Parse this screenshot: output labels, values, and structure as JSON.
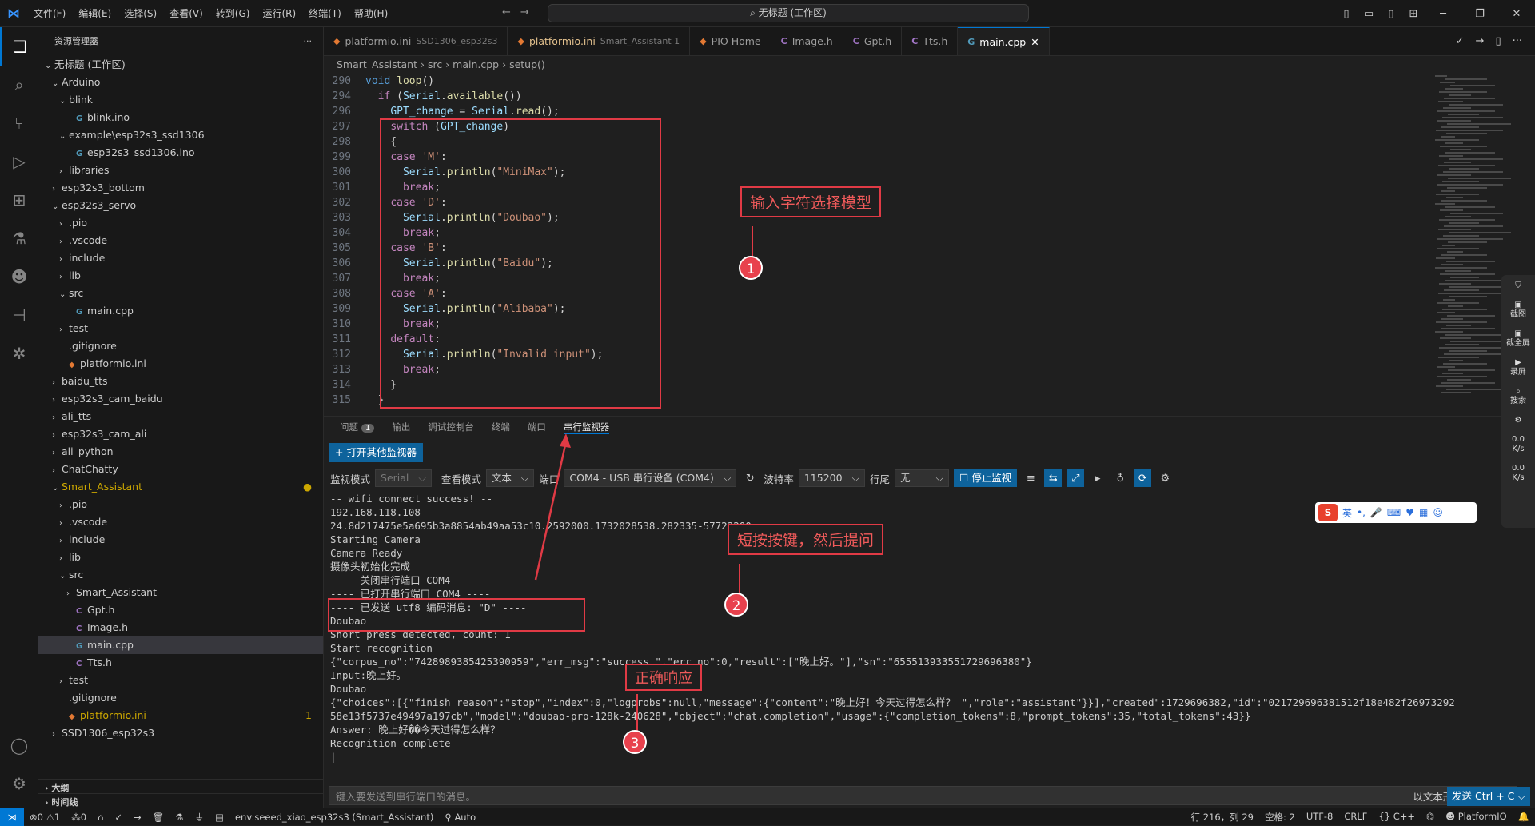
{
  "titlebar": {
    "menu": [
      "文件(F)",
      "编辑(E)",
      "选择(S)",
      "查看(V)",
      "转到(G)",
      "运行(R)",
      "终端(T)",
      "帮助(H)"
    ],
    "search": "无标题 (工作区)"
  },
  "sidebar": {
    "title": "资源管理器",
    "items": [
      {
        "label": "无标题 (工作区)",
        "indent": 0,
        "chev": "v",
        "icon": ""
      },
      {
        "label": "Arduino",
        "indent": 1,
        "chev": "v",
        "icon": ""
      },
      {
        "label": "blink",
        "indent": 2,
        "chev": "v",
        "icon": ""
      },
      {
        "label": "blink.ino",
        "indent": 3,
        "chev": "",
        "icon": "ino"
      },
      {
        "label": "example\\esp32s3_ssd1306",
        "indent": 2,
        "chev": "v",
        "icon": ""
      },
      {
        "label": "esp32s3_ssd1306.ino",
        "indent": 3,
        "chev": "",
        "icon": "ino"
      },
      {
        "label": "libraries",
        "indent": 2,
        "chev": ">",
        "icon": ""
      },
      {
        "label": "esp32s3_bottom",
        "indent": 1,
        "chev": ">",
        "icon": ""
      },
      {
        "label": "esp32s3_servo",
        "indent": 1,
        "chev": "v",
        "icon": ""
      },
      {
        "label": ".pio",
        "indent": 2,
        "chev": ">",
        "icon": ""
      },
      {
        "label": ".vscode",
        "indent": 2,
        "chev": ">",
        "icon": ""
      },
      {
        "label": "include",
        "indent": 2,
        "chev": ">",
        "icon": ""
      },
      {
        "label": "lib",
        "indent": 2,
        "chev": ">",
        "icon": ""
      },
      {
        "label": "src",
        "indent": 2,
        "chev": "v",
        "icon": ""
      },
      {
        "label": "main.cpp",
        "indent": 3,
        "chev": "",
        "icon": "cpp"
      },
      {
        "label": "test",
        "indent": 2,
        "chev": ">",
        "icon": ""
      },
      {
        "label": ".gitignore",
        "indent": 2,
        "chev": "",
        "icon": ""
      },
      {
        "label": "platformio.ini",
        "indent": 2,
        "chev": "",
        "icon": "ini"
      },
      {
        "label": "baidu_tts",
        "indent": 1,
        "chev": ">",
        "icon": ""
      },
      {
        "label": "esp32s3_cam_baidu",
        "indent": 1,
        "chev": ">",
        "icon": ""
      },
      {
        "label": "ali_tts",
        "indent": 1,
        "chev": ">",
        "icon": ""
      },
      {
        "label": "esp32s3_cam_ali",
        "indent": 1,
        "chev": ">",
        "icon": ""
      },
      {
        "label": "ali_python",
        "indent": 1,
        "chev": ">",
        "icon": ""
      },
      {
        "label": "ChatChatty",
        "indent": 1,
        "chev": ">",
        "icon": ""
      },
      {
        "label": "Smart_Assistant",
        "indent": 1,
        "chev": "v",
        "icon": "",
        "mod": true,
        "badge": "●"
      },
      {
        "label": ".pio",
        "indent": 2,
        "chev": ">",
        "icon": ""
      },
      {
        "label": ".vscode",
        "indent": 2,
        "chev": ">",
        "icon": ""
      },
      {
        "label": "include",
        "indent": 2,
        "chev": ">",
        "icon": ""
      },
      {
        "label": "lib",
        "indent": 2,
        "chev": ">",
        "icon": ""
      },
      {
        "label": "src",
        "indent": 2,
        "chev": "v",
        "icon": ""
      },
      {
        "label": "Smart_Assistant",
        "indent": 3,
        "chev": ">",
        "icon": ""
      },
      {
        "label": "Gpt.h",
        "indent": 3,
        "chev": "",
        "icon": "c"
      },
      {
        "label": "Image.h",
        "indent": 3,
        "chev": "",
        "icon": "c"
      },
      {
        "label": "main.cpp",
        "indent": 3,
        "chev": "",
        "icon": "cpp",
        "selected": true
      },
      {
        "label": "Tts.h",
        "indent": 3,
        "chev": "",
        "icon": "c"
      },
      {
        "label": "test",
        "indent": 2,
        "chev": ">",
        "icon": ""
      },
      {
        "label": ".gitignore",
        "indent": 2,
        "chev": "",
        "icon": ""
      },
      {
        "label": "platformio.ini",
        "indent": 2,
        "chev": "",
        "icon": "ini",
        "mod": true,
        "badge": "1"
      },
      {
        "label": "SSD1306_esp32s3",
        "indent": 1,
        "chev": ">",
        "icon": ""
      }
    ],
    "outline": "大纲",
    "timeline": "时间线"
  },
  "tabs": [
    {
      "label": "platformio.ini",
      "sub": "SSD1306_esp32s3",
      "icon": "ini"
    },
    {
      "label": "platformio.ini",
      "sub": "Smart_Assistant 1",
      "icon": "ini",
      "mod": true
    },
    {
      "label": "PIO Home",
      "sub": "",
      "icon": "ini"
    },
    {
      "label": "Image.h",
      "sub": "",
      "icon": "c"
    },
    {
      "label": "Gpt.h",
      "sub": "",
      "icon": "c"
    },
    {
      "label": "Tts.h",
      "sub": "",
      "icon": "c"
    },
    {
      "label": "main.cpp",
      "sub": "",
      "icon": "cpp",
      "active": true,
      "close": "✕"
    }
  ],
  "breadcrumb": [
    "Smart_Assistant",
    "src",
    "main.cpp",
    "setup()"
  ],
  "code": [
    {
      "ln": "290",
      "t": [
        [
          "kw",
          "void "
        ],
        [
          "fn",
          "loop"
        ],
        [
          "pl",
          "()"
        ]
      ]
    },
    {
      "ln": "294",
      "t": [
        [
          "pl",
          "  "
        ],
        [
          "ctl",
          "if"
        ],
        [
          "pl",
          " ("
        ],
        [
          "var",
          "Serial"
        ],
        [
          "pl",
          "."
        ],
        [
          "fn",
          "available"
        ],
        [
          "pl",
          "())"
        ]
      ]
    },
    {
      "ln": "296",
      "t": [
        [
          "pl",
          "    "
        ],
        [
          "var",
          "GPT_change"
        ],
        [
          "pl",
          " = "
        ],
        [
          "var",
          "Serial"
        ],
        [
          "pl",
          "."
        ],
        [
          "fn",
          "read"
        ],
        [
          "pl",
          "();"
        ]
      ]
    },
    {
      "ln": "297",
      "t": [
        [
          "pl",
          "    "
        ],
        [
          "ctl",
          "switch"
        ],
        [
          "pl",
          " ("
        ],
        [
          "var",
          "GPT_change"
        ],
        [
          "pl",
          ")"
        ]
      ]
    },
    {
      "ln": "298",
      "t": [
        [
          "pl",
          "    {"
        ]
      ]
    },
    {
      "ln": "299",
      "t": [
        [
          "pl",
          "    "
        ],
        [
          "ctl",
          "case"
        ],
        [
          "pl",
          " "
        ],
        [
          "str",
          "'M'"
        ],
        [
          "pl",
          ":"
        ]
      ]
    },
    {
      "ln": "300",
      "t": [
        [
          "pl",
          "      "
        ],
        [
          "var",
          "Serial"
        ],
        [
          "pl",
          "."
        ],
        [
          "fn",
          "println"
        ],
        [
          "pl",
          "("
        ],
        [
          "str",
          "\"MiniMax\""
        ],
        [
          "pl",
          ");"
        ]
      ]
    },
    {
      "ln": "301",
      "t": [
        [
          "pl",
          "      "
        ],
        [
          "ctl",
          "break"
        ],
        [
          "pl",
          ";"
        ]
      ]
    },
    {
      "ln": "302",
      "t": [
        [
          "pl",
          "    "
        ],
        [
          "ctl",
          "case"
        ],
        [
          "pl",
          " "
        ],
        [
          "str",
          "'D'"
        ],
        [
          "pl",
          ":"
        ]
      ]
    },
    {
      "ln": "303",
      "t": [
        [
          "pl",
          "      "
        ],
        [
          "var",
          "Serial"
        ],
        [
          "pl",
          "."
        ],
        [
          "fn",
          "println"
        ],
        [
          "pl",
          "("
        ],
        [
          "str",
          "\"Doubao\""
        ],
        [
          "pl",
          ");"
        ]
      ]
    },
    {
      "ln": "304",
      "t": [
        [
          "pl",
          "      "
        ],
        [
          "ctl",
          "break"
        ],
        [
          "pl",
          ";"
        ]
      ]
    },
    {
      "ln": "305",
      "t": [
        [
          "pl",
          "    "
        ],
        [
          "ctl",
          "case"
        ],
        [
          "pl",
          " "
        ],
        [
          "str",
          "'B'"
        ],
        [
          "pl",
          ":"
        ]
      ]
    },
    {
      "ln": "306",
      "t": [
        [
          "pl",
          "      "
        ],
        [
          "var",
          "Serial"
        ],
        [
          "pl",
          "."
        ],
        [
          "fn",
          "println"
        ],
        [
          "pl",
          "("
        ],
        [
          "str",
          "\"Baidu\""
        ],
        [
          "pl",
          ");"
        ]
      ]
    },
    {
      "ln": "307",
      "t": [
        [
          "pl",
          "      "
        ],
        [
          "ctl",
          "break"
        ],
        [
          "pl",
          ";"
        ]
      ]
    },
    {
      "ln": "308",
      "t": [
        [
          "pl",
          "    "
        ],
        [
          "ctl",
          "case"
        ],
        [
          "pl",
          " "
        ],
        [
          "str",
          "'A'"
        ],
        [
          "pl",
          ":"
        ]
      ]
    },
    {
      "ln": "309",
      "t": [
        [
          "pl",
          "      "
        ],
        [
          "var",
          "Serial"
        ],
        [
          "pl",
          "."
        ],
        [
          "fn",
          "println"
        ],
        [
          "pl",
          "("
        ],
        [
          "str",
          "\"Alibaba\""
        ],
        [
          "pl",
          ");"
        ]
      ]
    },
    {
      "ln": "310",
      "t": [
        [
          "pl",
          "      "
        ],
        [
          "ctl",
          "break"
        ],
        [
          "pl",
          ";"
        ]
      ]
    },
    {
      "ln": "311",
      "t": [
        [
          "pl",
          "    "
        ],
        [
          "ctl",
          "default"
        ],
        [
          "pl",
          ":"
        ]
      ]
    },
    {
      "ln": "312",
      "t": [
        [
          "pl",
          "      "
        ],
        [
          "var",
          "Serial"
        ],
        [
          "pl",
          "."
        ],
        [
          "fn",
          "println"
        ],
        [
          "pl",
          "("
        ],
        [
          "str",
          "\"Invalid input\""
        ],
        [
          "pl",
          ");"
        ]
      ]
    },
    {
      "ln": "313",
      "t": [
        [
          "pl",
          "      "
        ],
        [
          "ctl",
          "break"
        ],
        [
          "pl",
          ";"
        ]
      ]
    },
    {
      "ln": "314",
      "t": [
        [
          "pl",
          "    }"
        ]
      ]
    },
    {
      "ln": "315",
      "t": [
        [
          "pl",
          "  }"
        ]
      ]
    }
  ],
  "panel": {
    "tabs": [
      "问题",
      "输出",
      "调试控制台",
      "终端",
      "端口",
      "串行监视器"
    ],
    "problems_count": "1",
    "open_monitor": "打开其他监视器",
    "mode_label": "监视模式",
    "mode_value": "Serial",
    "view_label": "查看模式",
    "view_value": "文本",
    "port_label": "端口",
    "port_value": "COM4 - USB 串行设备 (COM4)",
    "baud_label": "波特率",
    "baud_value": "115200",
    "eol_label": "行尾",
    "eol_value": "无",
    "stop_label": "停止监视",
    "send_placeholder": "键入要发送到串行端口的消息。",
    "send_mode": "以文本形式发送",
    "send_button": "发送 Ctrl + C"
  },
  "monitor": [
    "-- wifi connect success! --",
    "192.168.118.108",
    "24.8d217475e5a695b3a8854ab49aa53c10.2592000.1732028538.282335-57722200",
    "Starting Camera",
    "Camera Ready",
    "摄像头初始化完成",
    "---- 关闭串行端口 COM4 ----",
    "---- 已打开串行端口 COM4 ----",
    "---- 已发送 utf8 编码消息: \"D\" ----",
    "Doubao",
    "Short press detected, count: 1",
    "Start recognition",
    "{\"corpus_no\":\"7428989385425390959\",\"err_msg\":\"success.\",\"err_no\":0,\"result\":[\"晚上好。\"],\"sn\":\"655513933551729696380\"}",
    "Input:晚上好。",
    "Doubao",
    "{\"choices\":[{\"finish_reason\":\"stop\",\"index\":0,\"logprobs\":null,\"message\":{\"content\":\"晚上好！今天过得怎么样？ \",\"role\":\"assistant\"}}],\"created\":1729696382,\"id\":\"021729696381512f18e482f26973292",
    "58e13f5737e49497a197cb\",\"model\":\"doubao-pro-128k-240628\",\"object\":\"chat.completion\",\"usage\":{\"completion_tokens\":8,\"prompt_tokens\":35,\"total_tokens\":43}}",
    "Answer: 晚上好��今天过得怎么样？",
    "Recognition complete"
  ],
  "annotations": {
    "a1": "输入字符选择模型",
    "a2": "短按按键，然后提问",
    "a3": "正确响应",
    "n1": "1",
    "n2": "2",
    "n3": "3"
  },
  "rightdock": [
    "截图",
    "截全屏",
    "录屏",
    "搜索",
    "0.0",
    "K/s",
    "0.0",
    "K/s"
  ],
  "ime": {
    "lang": "英"
  },
  "status": {
    "errors": "⊗0 ⚠1",
    "ports": "⁂0",
    "env": "env:seeed_xiao_esp32s3 (Smart_Assistant)",
    "auto": "Auto",
    "pos": "行 216，列 29",
    "spaces": "空格: 2",
    "enc": "UTF-8",
    "eol": "CRLF",
    "lang": "{} C++",
    "pio": "PlatformIO"
  }
}
